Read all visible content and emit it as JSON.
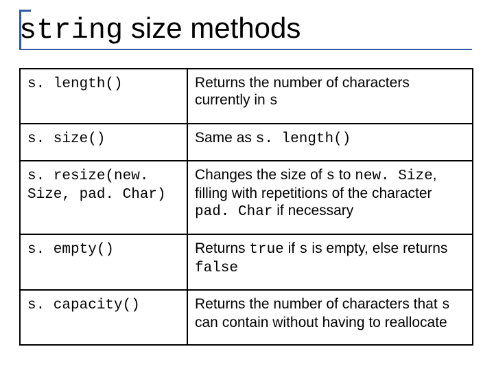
{
  "title": {
    "code": "string",
    "rest": " size methods"
  },
  "rows": [
    {
      "method_parts": [
        {
          "t": "s. length()",
          "mono": true
        }
      ],
      "desc_parts": [
        {
          "t": "Returns the number of characters currently in ",
          "mono": false
        },
        {
          "t": "s",
          "mono": true
        }
      ]
    },
    {
      "method_parts": [
        {
          "t": "s. size()",
          "mono": true
        }
      ],
      "desc_parts": [
        {
          "t": "Same as ",
          "mono": false
        },
        {
          "t": "s. length()",
          "mono": true
        }
      ]
    },
    {
      "method_parts": [
        {
          "t": "s. resize(new. Size, pad. Char)",
          "mono": true
        }
      ],
      "desc_parts": [
        {
          "t": "Changes the size of ",
          "mono": false
        },
        {
          "t": "s",
          "mono": true
        },
        {
          "t": " to ",
          "mono": false
        },
        {
          "t": "new. Size",
          "mono": true
        },
        {
          "t": ", filling with repetitions of the character ",
          "mono": false
        },
        {
          "t": "pad. Char",
          "mono": true
        },
        {
          "t": " if necessary",
          "mono": false
        }
      ]
    },
    {
      "method_parts": [
        {
          "t": "s. empty()",
          "mono": true
        }
      ],
      "desc_parts": [
        {
          "t": "Returns ",
          "mono": false
        },
        {
          "t": "true",
          "mono": true
        },
        {
          "t": " if ",
          "mono": false
        },
        {
          "t": "s",
          "mono": true
        },
        {
          "t": " is empty, else returns ",
          "mono": false
        },
        {
          "t": "false",
          "mono": true
        }
      ]
    },
    {
      "method_parts": [
        {
          "t": "s. capacity()",
          "mono": true
        }
      ],
      "desc_parts": [
        {
          "t": "Returns the number of characters that ",
          "mono": false
        },
        {
          "t": "s",
          "mono": true
        },
        {
          "t": " can contain without having to reallocate",
          "mono": false
        }
      ]
    }
  ]
}
